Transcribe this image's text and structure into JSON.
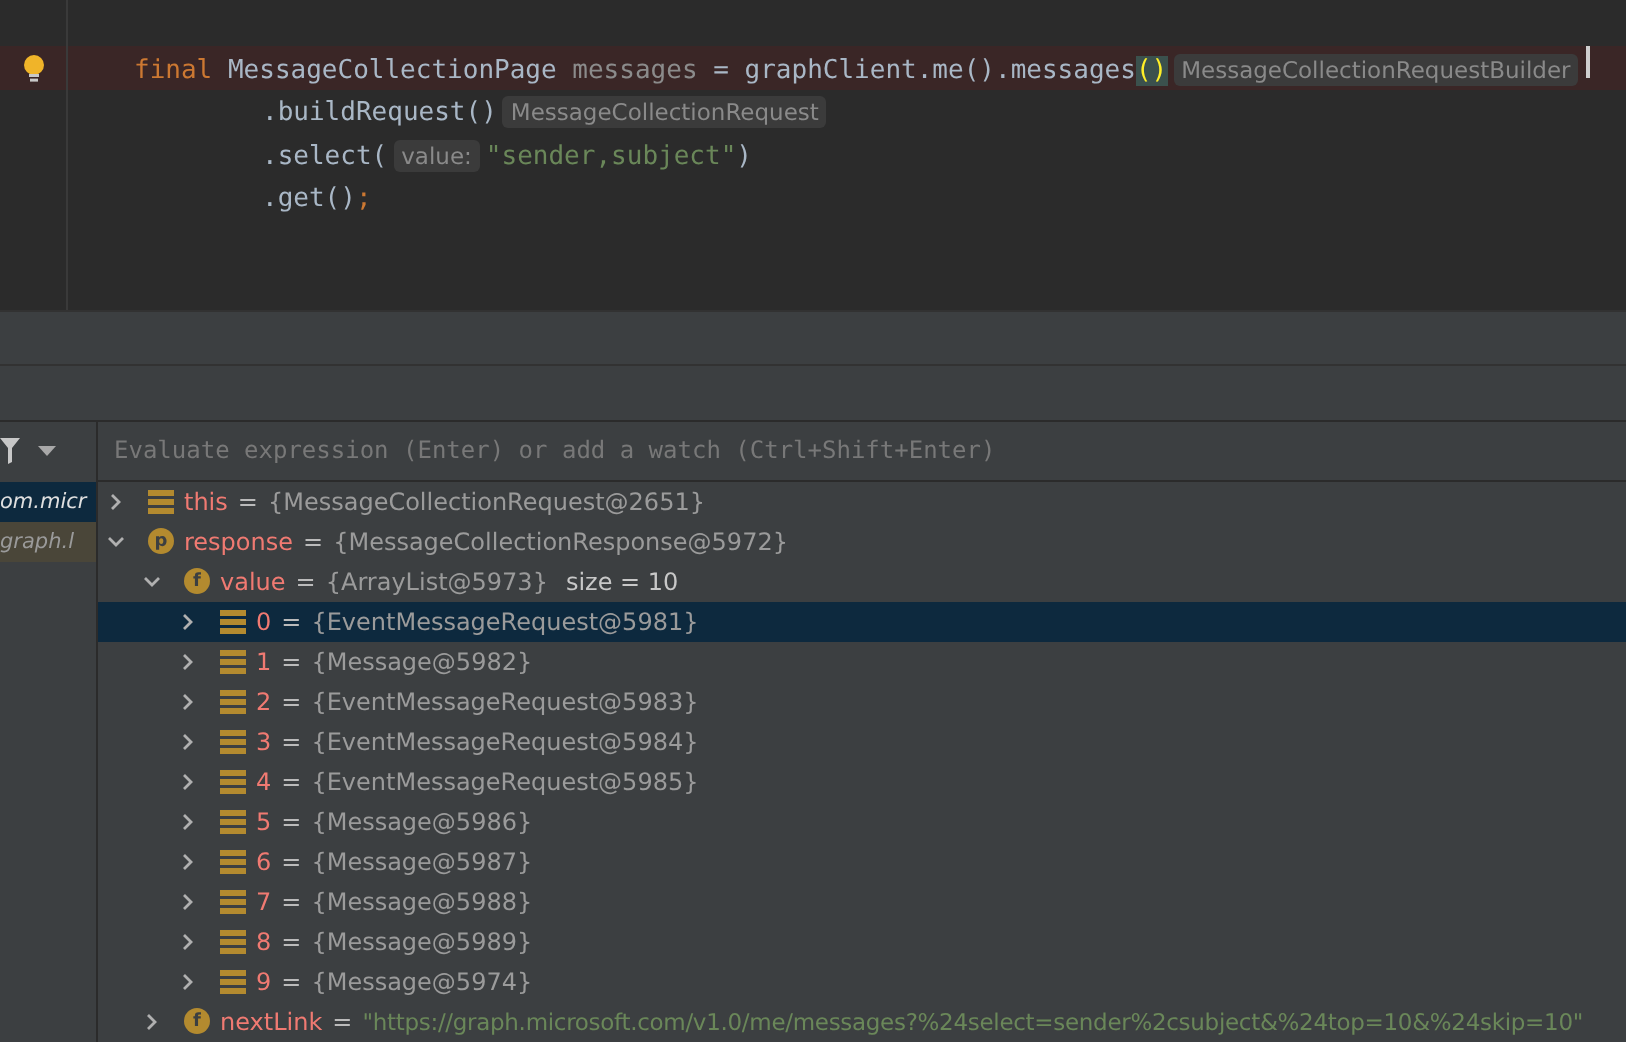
{
  "editor": {
    "lines": [
      {
        "kind": "statement",
        "highlighted": true,
        "bulb": true,
        "caret": true,
        "tokens": [
          {
            "kind": "keyword",
            "text": "final "
          },
          {
            "kind": "plain",
            "text": "MessageCollectionPage "
          },
          {
            "kind": "unused",
            "text": "messages "
          },
          {
            "kind": "plain",
            "text": "= graphClient.me().messages"
          },
          {
            "kind": "brace-match",
            "text": "()"
          },
          {
            "kind": "hint",
            "text": "MessageCollectionRequestBuilder"
          }
        ]
      },
      {
        "kind": "continuation",
        "highlighted": false,
        "bulb": false,
        "caret": false,
        "tokens": [
          {
            "kind": "plain",
            "text": ".buildRequest()"
          },
          {
            "kind": "hint",
            "text": "MessageCollectionRequest"
          }
        ]
      },
      {
        "kind": "continuation",
        "highlighted": false,
        "bulb": false,
        "caret": false,
        "tokens": [
          {
            "kind": "plain",
            "text": ".select("
          },
          {
            "kind": "hint",
            "text": "value:"
          },
          {
            "kind": "string",
            "text": "\"sender,subject\""
          },
          {
            "kind": "plain",
            "text": ")"
          }
        ]
      },
      {
        "kind": "continuation",
        "highlighted": false,
        "bulb": false,
        "caret": false,
        "tokens": [
          {
            "kind": "plain",
            "text": ".get()"
          },
          {
            "kind": "keyword",
            "text": ";"
          }
        ]
      }
    ]
  },
  "debugger": {
    "frames": [
      {
        "label": "om.micr",
        "selected": true
      },
      {
        "label": "graph.l",
        "selected": false
      }
    ],
    "watch_placeholder": "Evaluate expression (Enter) or add a watch (Ctrl+Shift+Enter)",
    "variables": [
      {
        "kind": "list",
        "name": "this",
        "sign": "=",
        "value": "{MessageCollectionRequest@2651}",
        "expanded": false,
        "selected": false
      },
      {
        "kind": "p",
        "name": "response",
        "sign": "=",
        "value": "{MessageCollectionResponse@5972}",
        "expanded": true,
        "selected": false,
        "children": [
          {
            "kind": "f",
            "name": "value",
            "sign": "=",
            "value": "{ArrayList@5973}",
            "extra": "size = 10",
            "expanded": true,
            "selected": false,
            "children": [
              {
                "kind": "list",
                "name": "0",
                "sign": "=",
                "value": "{EventMessageRequest@5981}",
                "expanded": false,
                "selected": true
              },
              {
                "kind": "list",
                "name": "1",
                "sign": "=",
                "value": "{Message@5982}",
                "expanded": false,
                "selected": false
              },
              {
                "kind": "list",
                "name": "2",
                "sign": "=",
                "value": "{EventMessageRequest@5983}",
                "expanded": false,
                "selected": false
              },
              {
                "kind": "list",
                "name": "3",
                "sign": "=",
                "value": "{EventMessageRequest@5984}",
                "expanded": false,
                "selected": false
              },
              {
                "kind": "list",
                "name": "4",
                "sign": "=",
                "value": "{EventMessageRequest@5985}",
                "expanded": false,
                "selected": false
              },
              {
                "kind": "list",
                "name": "5",
                "sign": "=",
                "value": "{Message@5986}",
                "expanded": false,
                "selected": false
              },
              {
                "kind": "list",
                "name": "6",
                "sign": "=",
                "value": "{Message@5987}",
                "expanded": false,
                "selected": false
              },
              {
                "kind": "list",
                "name": "7",
                "sign": "=",
                "value": "{Message@5988}",
                "expanded": false,
                "selected": false
              },
              {
                "kind": "list",
                "name": "8",
                "sign": "=",
                "value": "{Message@5989}",
                "expanded": false,
                "selected": false
              },
              {
                "kind": "list",
                "name": "9",
                "sign": "=",
                "value": "{Message@5974}",
                "expanded": false,
                "selected": false
              }
            ]
          },
          {
            "kind": "f",
            "name": "nextLink",
            "sign": "=",
            "string": "\"https://graph.microsoft.com/v1.0/me/messages?%24select=sender%2csubject&%24top=10&%24skip=10\"",
            "expanded": false,
            "selected": false
          }
        ]
      }
    ]
  }
}
